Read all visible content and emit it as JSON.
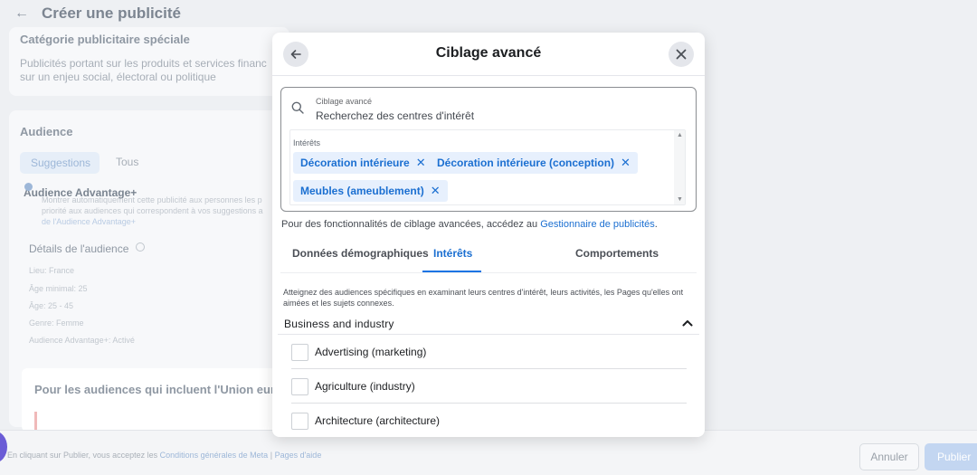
{
  "background": {
    "header_title": "Créer une publicité",
    "special_category_title": "Catégorie publicitaire spéciale",
    "special_category_text_1": "Publicités portant sur les produits et services financ",
    "special_category_text_2": "sur un enjeu social, électoral ou politique",
    "audience_title": "Audience",
    "tab_suggestions": "Suggestions",
    "tab_all": "Tous",
    "advantage_label": "Audience Advantage+",
    "advantage_desc_1": "Montrer automatiquement cette publicité aux personnes les p",
    "advantage_desc_2": "priorité aux audiences qui correspondent à vos suggestions a",
    "advantage_desc_3": "de l'Audience Advantage+",
    "details_title": "Détails de l'audience",
    "details": [
      "Lieu: France",
      "Âge minimal: 25",
      "Âge: 25 - 45",
      "Genre: Femme",
      "Audience Advantage+: Activé"
    ],
    "eu_title": "Pour les audiences qui incluent l'Union europ",
    "footer_text": "En cliquant sur Publier, vous acceptez les",
    "footer_link1": "Conditions générales de Meta",
    "footer_sep": "|",
    "footer_link2": "Pages d'aide",
    "cancel_label": "Annuler",
    "publish_label": "Publier"
  },
  "modal": {
    "title": "Ciblage avancé",
    "search": {
      "caption": "Ciblage avancé",
      "placeholder": "Recherchez des centres d'intérêt"
    },
    "interests": {
      "caption": "Intérêts",
      "chips": [
        "Décoration intérieure",
        "Décoration intérieure (conception)",
        "Meubles (ameublement)"
      ],
      "remove_symbol": "✕"
    },
    "hint_text": "Pour des fonctionnalités de ciblage avancées, accédez au",
    "hint_link": "Gestionnaire de publicités",
    "hint_end": ".",
    "tabs": [
      "Données démographiques",
      "Intérêts",
      "Comportements"
    ],
    "active_tab": "Intérêts",
    "description": "Atteignez des audiences spécifiques en examinant leurs centres d'intérêt, leurs activités, les Pages qu'elles ont aimées et les sujets connexes.",
    "section_title": "Business and industry",
    "options": [
      "Advertising (marketing)",
      "Agriculture (industry)",
      "Architecture (architecture)"
    ]
  },
  "colors": {
    "accent": "#1b74e4",
    "chip_bg": "#e7f0fd"
  },
  "icons": {
    "back": "arrow-left-icon",
    "close": "close-icon",
    "search": "search-icon",
    "collapse": "chevron-up-icon"
  }
}
